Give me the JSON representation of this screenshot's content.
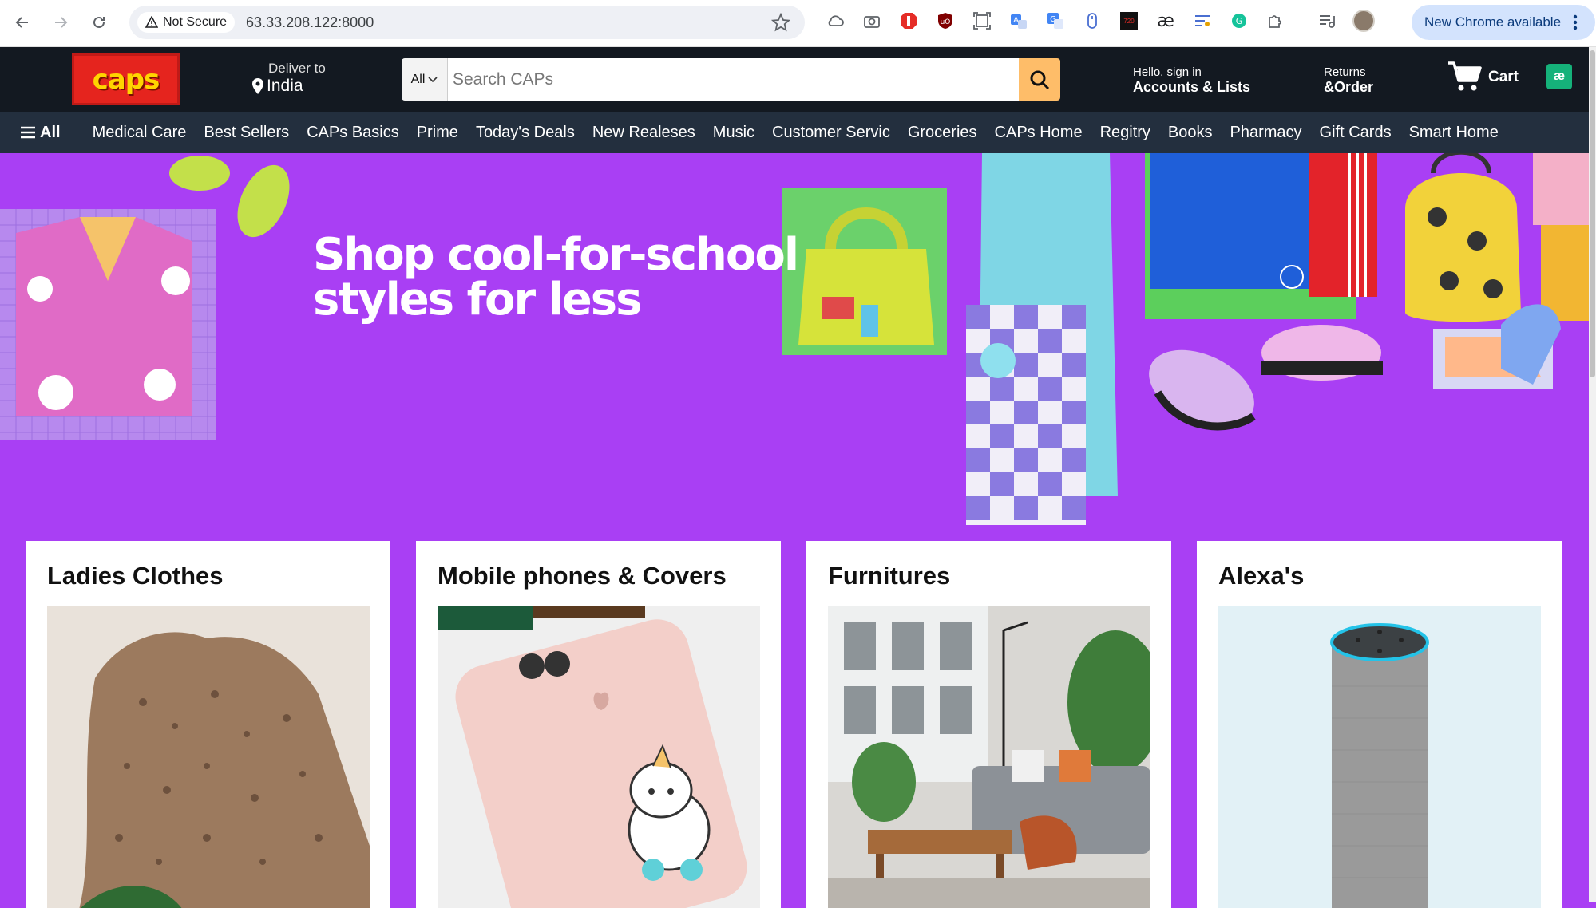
{
  "browser": {
    "security_label": "Not Secure",
    "url": "63.33.208.122:8000",
    "update_label": "New Chrome available",
    "extension_badge": "720"
  },
  "header": {
    "logo_text": "caps",
    "deliver_top": "Deliver to",
    "deliver_location": "India",
    "search_category": "All",
    "search_placeholder": "Search CAPs",
    "account_top": "Hello, sign in",
    "account_bottom": "Accounts & Lists",
    "returns_top": "Returns",
    "returns_bottom": "&Order",
    "cart_label": "Cart",
    "ext_badge": "æ"
  },
  "subnav": {
    "all_label": "All",
    "items": [
      "Medical Care",
      "Best Sellers",
      "CAPs Basics",
      "Prime",
      "Today's Deals",
      "New Realeses",
      "Music",
      "Customer Servic",
      "Groceries",
      "CAPs Home",
      "Regitry",
      "Books",
      "Pharmacy",
      "Gift Cards",
      "Smart Home"
    ]
  },
  "hero": {
    "line1": "Shop cool-for-school",
    "line2": "styles for less"
  },
  "cards": [
    {
      "title": "Ladies Clothes"
    },
    {
      "title": "Mobile phones & Covers"
    },
    {
      "title": "Furnitures"
    },
    {
      "title": "Alexa's"
    }
  ],
  "colors": {
    "header_bg": "#131921",
    "subnav_bg": "#232f3e",
    "hero_bg": "#a93ff4",
    "search_button": "#febd69"
  }
}
